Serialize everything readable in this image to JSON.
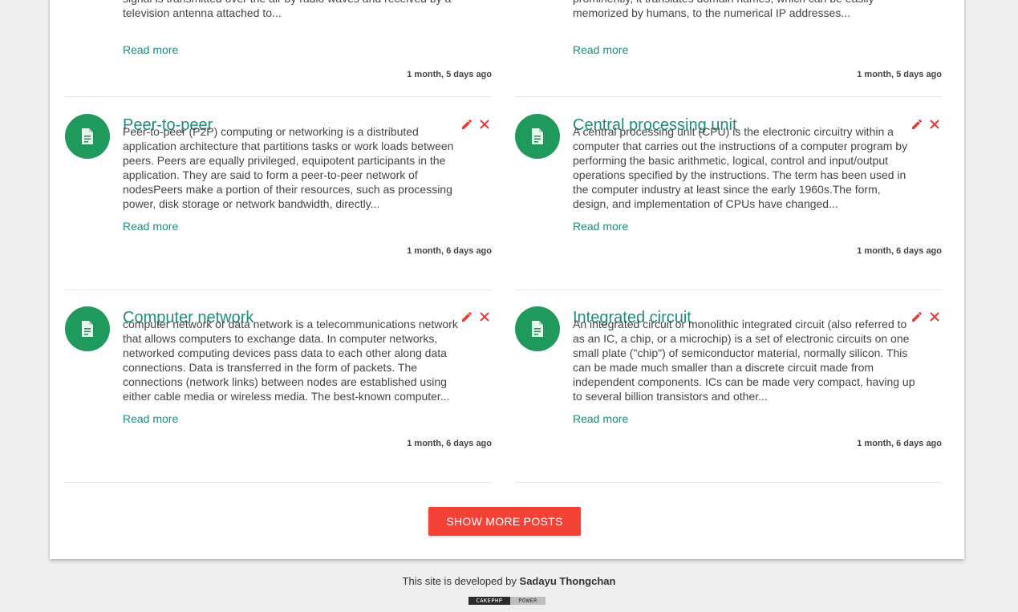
{
  "posts_top": [
    {
      "excerpt": "contrasts with traditional terrestrial television, in which the television signal is transmitted over the air by radio waves and received by a television antenna attached to...",
      "read_more": "Read more",
      "time": "1 month, 5 days ago"
    },
    {
      "excerpt": "domain names assigned to each of the participating entities. Most prominently, it translates domain names, which can be easily memorized by humans, to the numerical IP addresses...",
      "read_more": "Read more",
      "time": "1 month, 5 days ago"
    }
  ],
  "posts": [
    {
      "title": "Peer-to-peer",
      "excerpt": "Peer-to-peer (P2P) computing or networking is a distributed application architecture that partitions tasks or work loads between peers. Peers are equally privileged, equipotent participants in the application. They are said to form a peer-to-peer network of nodesPeers make a portion of their resources, such as processing power, disk storage or network bandwidth, directly...",
      "read_more": "Read more",
      "time": "1 month, 6 days ago"
    },
    {
      "title": "Central processing unit",
      "excerpt": "A central processing unit (CPU) is the electronic circuitry within a computer that carries out the instructions of a computer program by performing the basic arithmetic, logical, control and input/output operations specified by the instructions. The term has been used in the computer industry at least since the early 1960s.The form, design, and implementation of CPUs have changed...",
      "read_more": "Read more",
      "time": "1 month, 6 days ago"
    },
    {
      "title": "Computer network",
      "excerpt": "computer network or data network is a telecommunications network that allows computers to exchange data. In computer networks, networked computing devices pass data to each other along data connections. Data is transferred in the form of packets. The connections (network links) between nodes are established using either cable media or wireless media. The best-known computer...",
      "read_more": "Read more",
      "time": "1 month, 6 days ago"
    },
    {
      "title": "Integrated circuit",
      "excerpt": "An integrated circuit or monolithic integrated circuit (also referred to as an IC, a chip, or a microchip) is a set of electronic circuits on one small plate (\"chip\") of semiconductor material, normally silicon. This can be made much smaller than a discrete circuit made from independent components. ICs can be made very compact, having up to several billion transistors and other...",
      "read_more": "Read more",
      "time": "1 month, 6 days ago"
    }
  ],
  "icons": {
    "avatar": "document-icon",
    "edit": "pencil-icon",
    "delete": "close-icon"
  },
  "show_more_label": "SHOW MORE POSTS",
  "footer": {
    "prefix": "This site is developed by",
    "author": "Sadayu Thongchan",
    "badge_left": "CAKEPHP",
    "badge_right": "POWER"
  },
  "colors": {
    "accent": "#1f8b7c",
    "avatar": "#1f9a5c",
    "danger": "#e53935",
    "button": "#f44336",
    "background": "#eeeeee"
  }
}
